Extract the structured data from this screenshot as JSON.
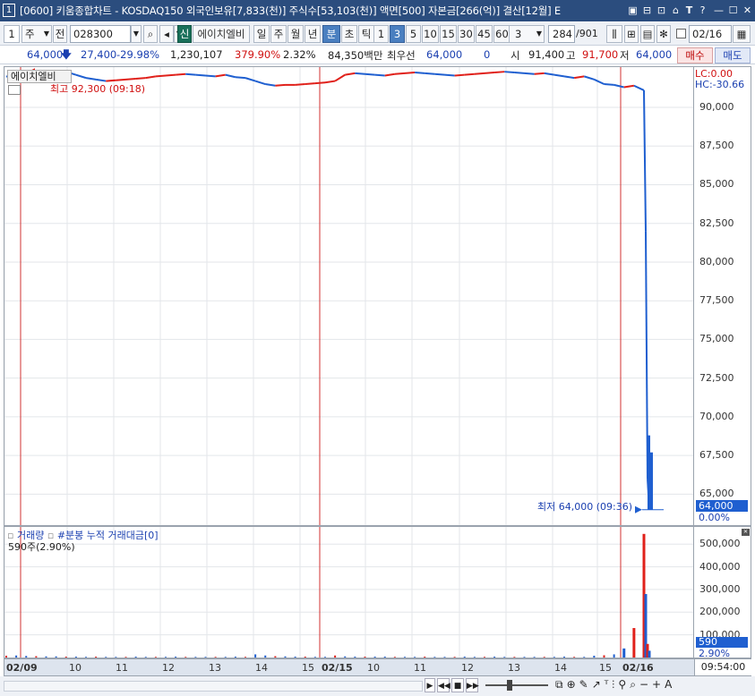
{
  "window": {
    "badge": "1",
    "title": "[0600] 키움종합차트 - KOSDAQ150 외국인보유[7,833(천)] 주식수[53,103(천)] 액면[500] 자본금[266(억)] 결산[12월] E",
    "icons": [
      "layout-icon",
      "save-window-icon",
      "restore-icon",
      "pin-icon",
      "font-icon",
      "help-icon",
      "minimize-icon",
      "maximize-icon",
      "close-icon"
    ]
  },
  "toolbar": {
    "num_badge": "1",
    "mode_select": "주",
    "prev_label": "전",
    "code": "028300",
    "sin_badge": "신",
    "stock_name": "에이치엘비",
    "period_buttons": [
      "일",
      "주",
      "월",
      "년",
      "분",
      "초",
      "틱"
    ],
    "period_selected": "분",
    "interval_buttons": [
      "1",
      "3",
      "5",
      "10",
      "15",
      "30",
      "45",
      "60"
    ],
    "interval_selected": "3",
    "interval_select": "3",
    "count": "284",
    "count_total": "/901",
    "date": "02/16"
  },
  "quote": {
    "price": "64,000",
    "change": "27,400",
    "change_pct": "-29.98%",
    "volume": "1,230,107",
    "vol_ratio": "379.90%",
    "turnover": "2.32%",
    "amount": "84,350백만",
    "best_ask_label": "최우선",
    "best_ask": "64,000",
    "best_bid": "0",
    "open_label": "시",
    "open": "91,400",
    "high_label": "고",
    "high": "91,700",
    "low_label": "저",
    "low": "64,000",
    "buy_label": "매수",
    "sell_label": "매도"
  },
  "price_panel": {
    "legend": "에이치엘비",
    "max_label": "최고 92,300 (09:18)",
    "min_label": "최저 64,000 (09:36)",
    "lc": "LC:0.00",
    "hc": "HC:-30.66",
    "current_price": "64,000",
    "current_pct": "0.00%",
    "y_ticks": [
      "90,000",
      "87,500",
      "85,000",
      "82,500",
      "80,000",
      "77,500",
      "75,000",
      "72,500",
      "70,000",
      "67,500",
      "65,000"
    ]
  },
  "volume_panel": {
    "legend_a": "거래량",
    "legend_b": "#분봉 누적 거래대금[0]",
    "current": "590주(2.90%)",
    "y_ticks": [
      "500,000",
      "400,000",
      "300,000",
      "200,000",
      "100,000"
    ],
    "current_vol": "590",
    "current_pct": "2.90%"
  },
  "xaxis": {
    "labels": [
      "02/09",
      "10",
      "11",
      "12",
      "13",
      "14",
      "15",
      "02/15",
      "10",
      "11",
      "12",
      "13",
      "14",
      "15",
      "02/16"
    ],
    "time": "09:54:00"
  },
  "colors": {
    "up": "#e0201a",
    "down": "#1f5fd0",
    "divider": "#d23030",
    "title_bg": "#2b4d7e"
  },
  "chart_data": {
    "type": "line",
    "title": "에이치엘비",
    "xlabel": "",
    "ylabel": "",
    "ylim": [
      63000,
      92600
    ],
    "x_sessions": [
      "02/09",
      "02/15",
      "02/16"
    ],
    "price_series": [
      {
        "name": "에이치엘비",
        "values": [
          92000,
          91900,
          91750,
          91800,
          92000,
          92200,
          92300,
          92100,
          91900,
          91800,
          91700,
          91750,
          91800,
          91850,
          91900,
          92000,
          92050,
          92100,
          92150,
          92100,
          92050,
          92000,
          92100,
          91950,
          91900,
          91700,
          91500,
          91400,
          91450,
          91450,
          91500,
          91550,
          91600,
          91700,
          92100,
          92200,
          92150,
          92100,
          92050,
          92150,
          92200,
          92250,
          92200,
          92150,
          92100,
          92050,
          92100,
          92150,
          92200,
          92250,
          92300,
          92250,
          92200,
          92150,
          92200,
          92100,
          92000,
          91900,
          92000,
          91800,
          91500,
          91450,
          91300,
          91400,
          91100,
          82000,
          66000,
          64000
        ]
      }
    ],
    "volume_series": [
      {
        "name": "거래량",
        "values": [
          8000,
          9000,
          7000,
          6000,
          5000,
          5000,
          4000,
          4000,
          3000,
          4000,
          3000,
          3000,
          3000,
          4000,
          3000,
          3000,
          3000,
          4000,
          3000,
          3000,
          3000,
          3000,
          3000,
          4000,
          3000,
          14000,
          9000,
          6000,
          5000,
          4000,
          4000,
          3000,
          3000,
          9000,
          5000,
          4000,
          4000,
          4000,
          4000,
          3000,
          3000,
          3000,
          4000,
          3000,
          3000,
          3000,
          4000,
          3000,
          3000,
          4000,
          3000,
          3000,
          3000,
          3000,
          3000,
          3000,
          4000,
          3000,
          3000,
          8000,
          10000,
          14000,
          40000,
          130000,
          545000,
          280000,
          60000,
          30000
        ]
      }
    ]
  }
}
